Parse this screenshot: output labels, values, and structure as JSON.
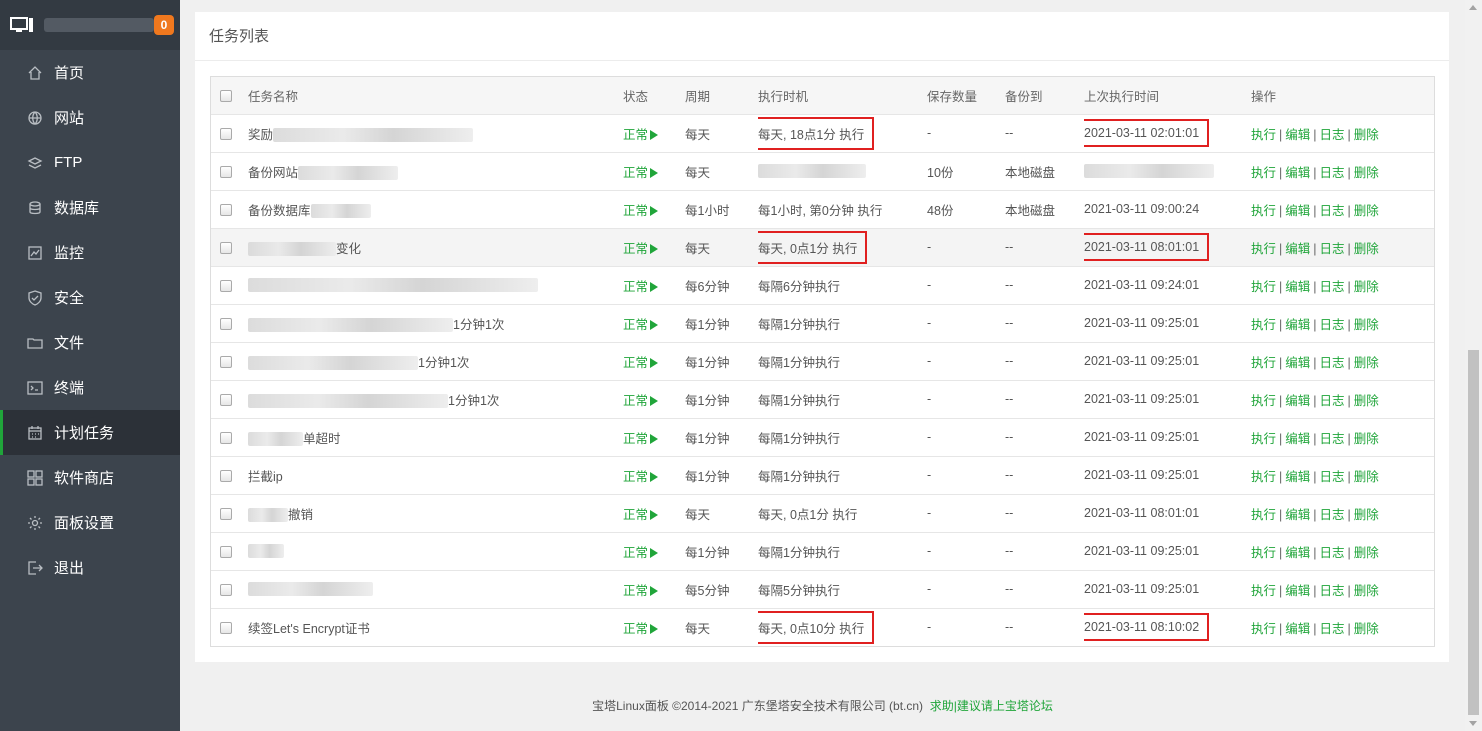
{
  "sidebar": {
    "badge": "0",
    "items": [
      {
        "label": "首页",
        "icon": "home-icon",
        "active": false
      },
      {
        "label": "网站",
        "icon": "globe-icon",
        "active": false
      },
      {
        "label": "FTP",
        "icon": "ftp-icon",
        "active": false
      },
      {
        "label": "数据库",
        "icon": "database-icon",
        "active": false
      },
      {
        "label": "监控",
        "icon": "monitor-icon",
        "active": false
      },
      {
        "label": "安全",
        "icon": "shield-icon",
        "active": false
      },
      {
        "label": "文件",
        "icon": "folder-icon",
        "active": false
      },
      {
        "label": "终端",
        "icon": "terminal-icon",
        "active": false
      },
      {
        "label": "计划任务",
        "icon": "calendar-icon",
        "active": true
      },
      {
        "label": "软件商店",
        "icon": "apps-icon",
        "active": false
      },
      {
        "label": "面板设置",
        "icon": "gear-icon",
        "active": false
      },
      {
        "label": "退出",
        "icon": "logout-icon",
        "active": false
      }
    ]
  },
  "panel": {
    "title": "任务列表",
    "columns": [
      "任务名称",
      "状态",
      "周期",
      "执行时机",
      "保存数量",
      "备份到",
      "上次执行时间",
      "操作"
    ],
    "status_label": "正常",
    "ops": {
      "run": "执行",
      "edit": "编辑",
      "log": "日志",
      "del": "删除"
    },
    "rows": [
      {
        "name": "奖励",
        "cycle": "每天",
        "timing": "每天, 18点1分 执行",
        "save": "-",
        "backup": "--",
        "last": "2021-03-11 02:01:01"
      },
      {
        "name": "备份网站",
        "cycle": "每天",
        "timing": "",
        "save": "10份",
        "backup": "本地磁盘",
        "last": ""
      },
      {
        "name": "备份数据库",
        "cycle": "每1小时",
        "timing": "每1小时, 第0分钟 执行",
        "save": "48份",
        "backup": "本地磁盘",
        "last": "2021-03-11 09:00:24"
      },
      {
        "name": "变化",
        "cycle": "每天",
        "timing": "每天, 0点1分 执行",
        "save": "-",
        "backup": "--",
        "last": "2021-03-11 08:01:01"
      },
      {
        "name": "",
        "cycle": "每6分钟",
        "timing": "每隔6分钟执行",
        "save": "-",
        "backup": "--",
        "last": "2021-03-11 09:24:01"
      },
      {
        "name": "1分钟1次",
        "cycle": "每1分钟",
        "timing": "每隔1分钟执行",
        "save": "-",
        "backup": "--",
        "last": "2021-03-11 09:25:01"
      },
      {
        "name": "1分钟1次",
        "cycle": "每1分钟",
        "timing": "每隔1分钟执行",
        "save": "-",
        "backup": "--",
        "last": "2021-03-11 09:25:01"
      },
      {
        "name": "1分钟1次",
        "cycle": "每1分钟",
        "timing": "每隔1分钟执行",
        "save": "-",
        "backup": "--",
        "last": "2021-03-11 09:25:01"
      },
      {
        "name": "单超时",
        "cycle": "每1分钟",
        "timing": "每隔1分钟执行",
        "save": "-",
        "backup": "--",
        "last": "2021-03-11 09:25:01"
      },
      {
        "name": "拦截ip",
        "cycle": "每1分钟",
        "timing": "每隔1分钟执行",
        "save": "-",
        "backup": "--",
        "last": "2021-03-11 09:25:01"
      },
      {
        "name": "撤销",
        "cycle": "每天",
        "timing": "每天, 0点1分 执行",
        "save": "-",
        "backup": "--",
        "last": "2021-03-11 08:01:01"
      },
      {
        "name": "",
        "cycle": "每1分钟",
        "timing": "每隔1分钟执行",
        "save": "-",
        "backup": "--",
        "last": "2021-03-11 09:25:01"
      },
      {
        "name": "",
        "cycle": "每5分钟",
        "timing": "每隔5分钟执行",
        "save": "-",
        "backup": "--",
        "last": "2021-03-11 09:25:01"
      },
      {
        "name": "续签Let's Encrypt证书",
        "cycle": "每天",
        "timing": "每天, 0点10分 执行",
        "save": "-",
        "backup": "--",
        "last": "2021-03-11 08:10:02"
      }
    ]
  },
  "footer": {
    "copyright": "宝塔Linux面板 ©2014-2021 广东堡塔安全技术有限公司 (bt.cn)",
    "help_link": "求助|建议请上宝塔论坛"
  },
  "colors": {
    "accent": "#20a53a",
    "sidebar": "#3c444d",
    "highlight": "#e02020",
    "badge": "#f0781e"
  }
}
